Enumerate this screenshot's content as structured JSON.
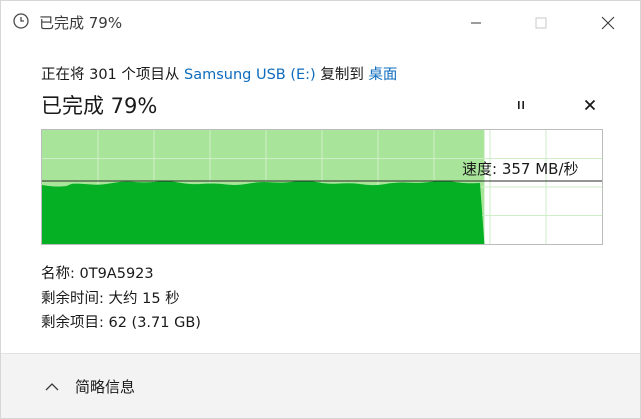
{
  "window": {
    "title": "已完成 79%",
    "icon": "clock-icon"
  },
  "copy": {
    "prefix": "正在将 301 个项目从 ",
    "source": "Samsung USB (E:)",
    "middle": " 复制到 ",
    "destination": "桌面"
  },
  "progress": {
    "heading": "已完成 79%",
    "percent": 79,
    "speed_label": "速度: 357 MB/秒"
  },
  "details": {
    "name": "名称: 0T9A5923",
    "time_remaining": "剩余时间: 大约 15 秒",
    "items_remaining": "剩余项目: 62 (3.71 GB)"
  },
  "footer": {
    "toggle_label": "简略信息"
  },
  "colors": {
    "accent_link": "#0f6cbd",
    "graph_fill": "#06b025",
    "graph_progress_bg": "#a8e59a"
  }
}
